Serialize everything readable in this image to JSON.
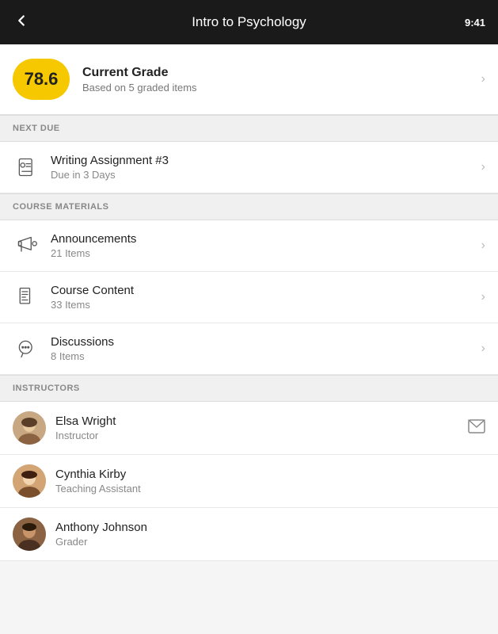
{
  "header": {
    "title": "Intro to Psychology",
    "back_label": "‹",
    "time": "9:41"
  },
  "grade": {
    "value": "78.6",
    "title": "Current Grade",
    "subtitle": "Based on 5 graded items"
  },
  "sections": {
    "next_due": {
      "label": "NEXT DUE",
      "items": [
        {
          "title": "Writing Assignment #3",
          "subtitle": "Due in 3 Days"
        }
      ]
    },
    "course_materials": {
      "label": "COURSE MATERIALS",
      "items": [
        {
          "title": "Announcements",
          "subtitle": "21 Items"
        },
        {
          "title": "Course Content",
          "subtitle": "33 Items"
        },
        {
          "title": "Discussions",
          "subtitle": "8 Items"
        }
      ]
    },
    "instructors": {
      "label": "INSTRUCTORS",
      "items": [
        {
          "name": "Elsa Wright",
          "role": "Instructor",
          "has_mail": true
        },
        {
          "name": "Cynthia Kirby",
          "role": "Teaching Assistant",
          "has_mail": false
        },
        {
          "name": "Anthony Johnson",
          "role": "Grader",
          "has_mail": false
        }
      ]
    }
  }
}
